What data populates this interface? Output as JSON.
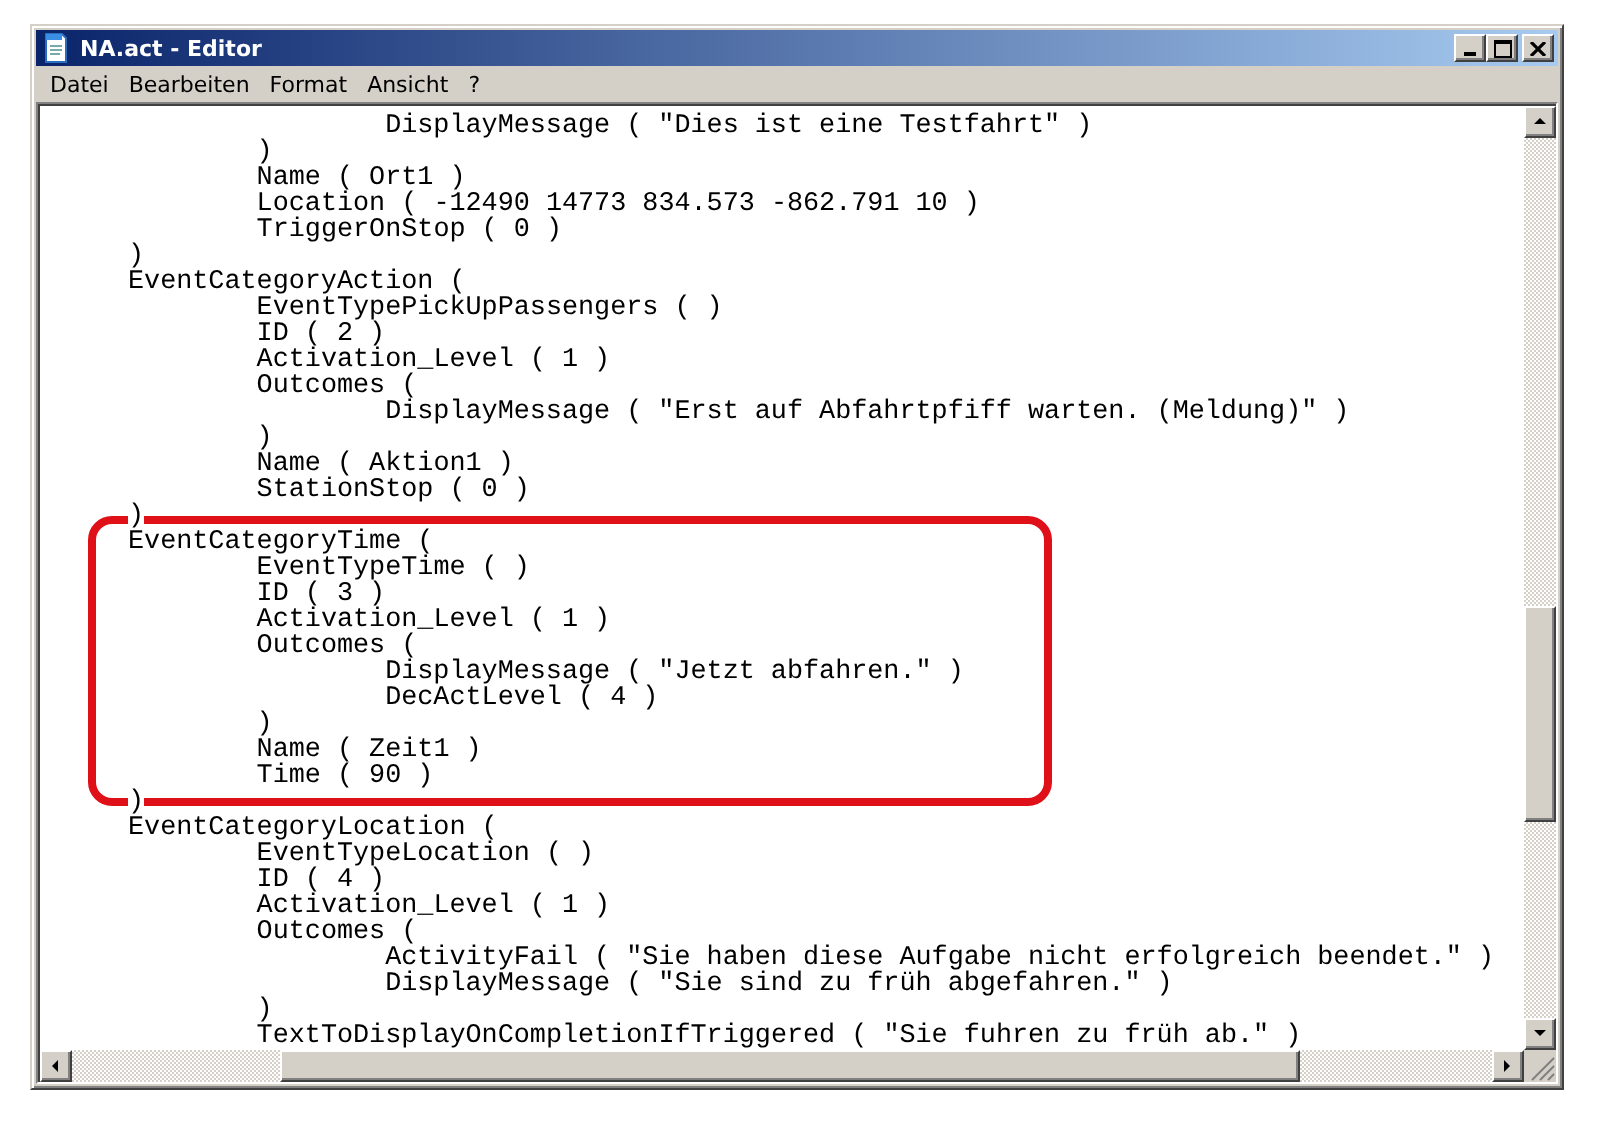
{
  "window": {
    "title": "NA.act - Editor"
  },
  "menu": [
    {
      "label": "Datei"
    },
    {
      "label": "Bearbeiten"
    },
    {
      "label": "Format"
    },
    {
      "label": "Ansicht"
    },
    {
      "label": "?"
    }
  ],
  "blocks": [
    {
      "highlighted": false,
      "lines": [
        "\t\tDisplayMessage ( \"Dies ist eine Testfahrt\" )",
        "\t)",
        "\tName ( Ort1 )",
        "\tLocation ( -12490 14773 834.573 -862.791 10 )",
        "\tTriggerOnStop ( 0 )",
        ")",
        "EventCategoryAction (",
        "\tEventTypePickUpPassengers ( )",
        "\tID ( 2 )",
        "\tActivation_Level ( 1 )",
        "\tOutcomes (",
        "\t\tDisplayMessage ( \"Erst auf Abfahrtpfiff warten. (Meldung)\" )",
        "\t)",
        "\tName ( Aktion1 )",
        "\tStationStop ( 0 )",
        ")"
      ]
    },
    {
      "highlighted": true,
      "lines": [
        "EventCategoryTime (",
        "\tEventTypeTime ( )",
        "\tID ( 3 )",
        "\tActivation_Level ( 1 )",
        "\tOutcomes (",
        "\t\tDisplayMessage ( \"Jetzt abfahren.\" )",
        "\t\tDecActLevel ( 4 )",
        "\t)",
        "\tName ( Zeit1 )",
        "\tTime ( 90 )"
      ]
    },
    {
      "highlighted": false,
      "lines": [
        ")",
        "EventCategoryLocation (",
        "\tEventTypeLocation ( )",
        "\tID ( 4 )",
        "\tActivation_Level ( 1 )",
        "\tOutcomes (",
        "\t\tActivityFail ( \"Sie haben diese Aufgabe nicht erfolgreich beendet.\" )",
        "\t\tDisplayMessage ( \"Sie sind zu früh abgefahren.\" )",
        "\t)",
        "\tTextToDisplayOnCompletionIfTriggered ( \"Sie fuhren zu früh ab.\" )"
      ]
    }
  ]
}
